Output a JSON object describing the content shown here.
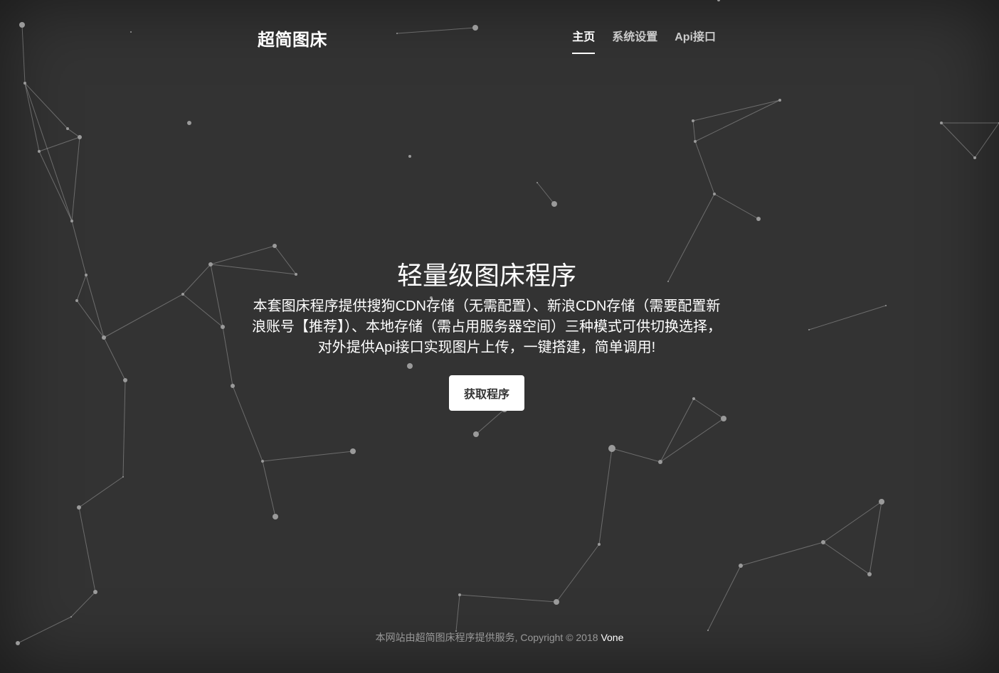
{
  "header": {
    "brand": "超简图床",
    "nav": [
      {
        "label": "主页",
        "active": true
      },
      {
        "label": "系统设置",
        "active": false
      },
      {
        "label": "Api接口",
        "active": false
      }
    ]
  },
  "main": {
    "heading": "轻量级图床程序",
    "description": "本套图床程序提供搜狗CDN存储（无需配置）、新浪CDN存储（需要配置新浪账号【推荐】）、本地存储（需占用服务器空间）三种模式可供切换选择，对外提供Api接口实现图片上传，一键搭建，简单调用!",
    "button_label": "获取程序"
  },
  "footer": {
    "text": "本网站由超简图床程序提供服务, Copyright © 2018 ",
    "author": "Vone"
  },
  "colors": {
    "background": "#333333",
    "text": "#ffffff",
    "particle": "#9a9a9a"
  }
}
